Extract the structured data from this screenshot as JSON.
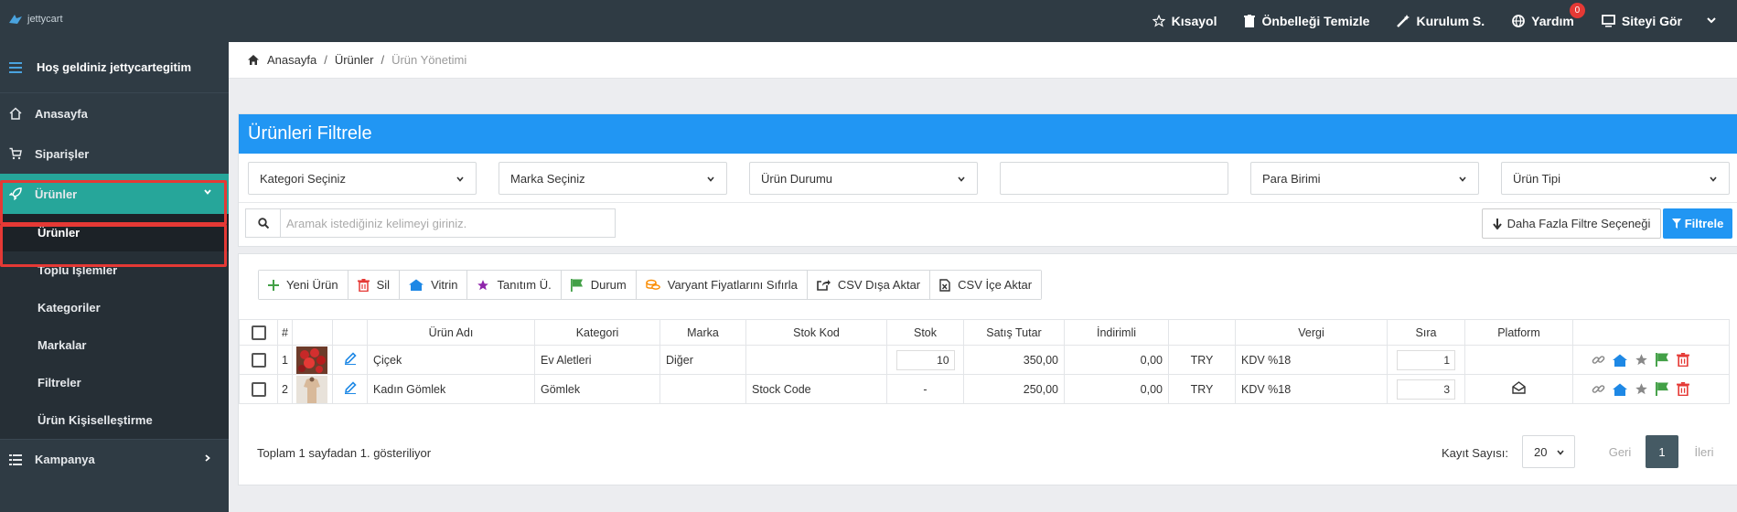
{
  "topbar": {
    "logo_text": "jettycart",
    "nav": [
      {
        "label": "Kısayol",
        "icon": "star-icon"
      },
      {
        "label": "Önbelleği Temizle",
        "icon": "trash-icon"
      },
      {
        "label": "Kurulum S.",
        "icon": "magic-wand-icon"
      },
      {
        "label": "Yardım",
        "icon": "globe-icon",
        "badge": "0"
      },
      {
        "label": "Siteyi Gör",
        "icon": "monitor-icon"
      }
    ]
  },
  "sidebar": {
    "welcome": "Hoş geldiniz jettycartegitim",
    "items": [
      {
        "label": "Anasayfa",
        "icon": "home-icon"
      },
      {
        "label": "Siparişler",
        "icon": "cart-icon"
      },
      {
        "label": "Ürünler",
        "icon": "rocket-icon"
      }
    ],
    "subitems": [
      "Ürünler",
      "Toplu İşlemler",
      "Kategoriler",
      "Markalar",
      "Filtreler",
      "Ürün Kişiselleştirme"
    ],
    "bottom_item": {
      "label": "Kampanya",
      "icon": "list-icon"
    }
  },
  "breadcrumb": {
    "home": "Anasayfa",
    "separator": "/",
    "level1": "Ürünler",
    "current": "Ürün Yönetimi"
  },
  "filter_panel": {
    "title": "Ürünleri Filtrele",
    "selects": [
      "Kategori Seçiniz",
      "Marka Seçiniz",
      "Ürün Durumu",
      "",
      "Para Birimi",
      "Ürün Tipi"
    ],
    "search_placeholder": "Aramak istediğiniz kelimeyi giriniz.",
    "more_filters_label": "Daha Fazla Filtre Seçeneği",
    "filter_button_label": "Filtrele"
  },
  "toolbar": [
    {
      "label": "Yeni Ürün",
      "icon": "plus-icon",
      "color": "#43a047"
    },
    {
      "label": "Sil",
      "icon": "trash-icon",
      "color": "#e53935"
    },
    {
      "label": "Vitrin",
      "icon": "home-icon",
      "color": "#1e88e5"
    },
    {
      "label": "Tanıtım Ü.",
      "icon": "star-icon",
      "color": "#8e24aa"
    },
    {
      "label": "Durum",
      "icon": "flag-icon",
      "color": "#43a047"
    },
    {
      "label": "Varyant Fiyatlarını Sıfırla",
      "icon": "coins-icon",
      "color": "#fb8c00"
    },
    {
      "label": "CSV Dışa Aktar",
      "icon": "export-icon",
      "color": "#333333"
    },
    {
      "label": "CSV İçe Aktar",
      "icon": "csv-file-icon",
      "color": "#333333"
    }
  ],
  "table": {
    "headers": [
      "#",
      "Ürün Adı",
      "Kategori",
      "Marka",
      "Stok Kod",
      "Stok",
      "Satış Tutar",
      "İndirimli",
      "Vergi",
      "Sıra",
      "Platform"
    ],
    "rows": [
      {
        "num": "1",
        "name": "Çiçek",
        "category": "Ev Aletleri",
        "brand": "Diğer",
        "stock_code": "",
        "stock": "10",
        "price": "350,00",
        "discounted": "0,00",
        "currency": "TRY",
        "tax": "KDV %18",
        "order": "1",
        "platform": ""
      },
      {
        "num": "2",
        "name": "Kadın Gömlek",
        "category": "Gömlek",
        "brand": "",
        "stock_code": "Stock Code",
        "stock": "-",
        "price": "250,00",
        "discounted": "0,00",
        "currency": "TRY",
        "tax": "KDV %18",
        "order": "3",
        "platform": "envelope-open-icon"
      }
    ]
  },
  "footer": {
    "summary": "Toplam 1 sayfadan 1. gösteriliyor",
    "page_size_label": "Kayıt Sayısı:",
    "page_size": "20",
    "prev": "Geri",
    "page": "1",
    "next": "İleri"
  },
  "colors": {
    "topbar": "#2f3b44",
    "accent": "#26a69a",
    "primary": "#2196f3",
    "highlight": "#e53935"
  }
}
